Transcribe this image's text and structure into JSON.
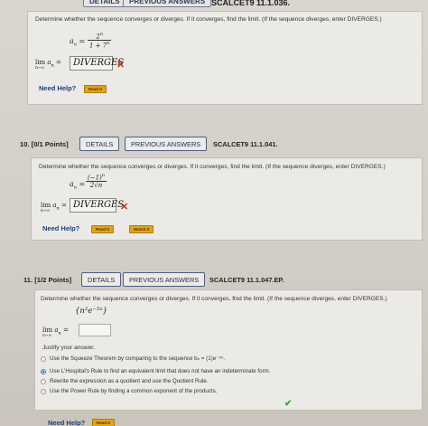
{
  "top": {
    "details_label": "DETAILS",
    "previous_answers_label": "PREVIOUS ANSWERS",
    "code": "SCALCET9 11.1.036."
  },
  "q9": {
    "prompt": "Determine whether the sequence converges or diverges. If it converges, find the limit. (If the sequence diverges, enter DIVERGES.)",
    "an_lhs": "a",
    "an_sub": "n",
    "num": "2",
    "num_sup": "n",
    "den": "1 + 7",
    "den_sup": "n",
    "lim_label": "lim",
    "lim_sub": "n→∞",
    "lim_var": "a",
    "lim_var_sub": "n",
    "answer": "DIVERGES",
    "mark": "✕",
    "need_help": "Need Help?",
    "read_it": "Read It"
  },
  "q10": {
    "title": "10.  [0/1 Points]",
    "details_label": "DETAILS",
    "previous_answers_label": "PREVIOUS ANSWERS",
    "code": "SCALCET9 11.1.041.",
    "prompt": "Determine whether the sequence converges or diverges. If it converges, find the limit. (If the sequence diverges, enter DIVERGES.)",
    "an_lhs": "a",
    "an_sub": "n",
    "num": "(−1)",
    "num_sup": "n",
    "den": "2√n",
    "lim_label": "lim",
    "lim_sub": "n→∞",
    "lim_var": "a",
    "lim_var_sub": "n",
    "answer": "DIVERGES",
    "mark": "✕",
    "need_help": "Need Help?",
    "read_it": "Read It",
    "watch_it": "Watch It"
  },
  "q11": {
    "title": "11.  [1/2 Points]",
    "details_label": "DETAILS",
    "previous_answers_label": "PREVIOUS ANSWERS",
    "code": "SCALCET9 11.1.047.EP.",
    "prompt": "Determine whether the sequence converges or diverges. If it converges, find the limit. (If the sequence diverges, enter DIVERGES.)",
    "sequence": "{n²e⁻⁵ⁿ}",
    "lim_label": "lim",
    "lim_sub": "n→∞",
    "lim_var": "a",
    "lim_var_sub": "n",
    "answer": "",
    "justify_label": "Justify your answer.",
    "options": [
      {
        "label": "Use the Squeeze Theorem by comparing to the sequence bₙ = (1)e⁻⁵ⁿ.",
        "selected": false
      },
      {
        "label": "Use L'Hospital's Rule to find an equivalent limit that does not have an indeterminate form.",
        "selected": true
      },
      {
        "label": "Rewrite the expression as a quotient and use the Quotient Rule.",
        "selected": false
      },
      {
        "label": "Use the Power Rule by finding a common exponent of the products.",
        "selected": false
      }
    ],
    "check": "✔",
    "need_help": "Need Help?",
    "read_it": "Read It"
  },
  "colors": {
    "wrong": "#c92a1e",
    "correct": "#3aa23a",
    "help_button": "#e0a41c",
    "link": "#1e3d7a"
  }
}
